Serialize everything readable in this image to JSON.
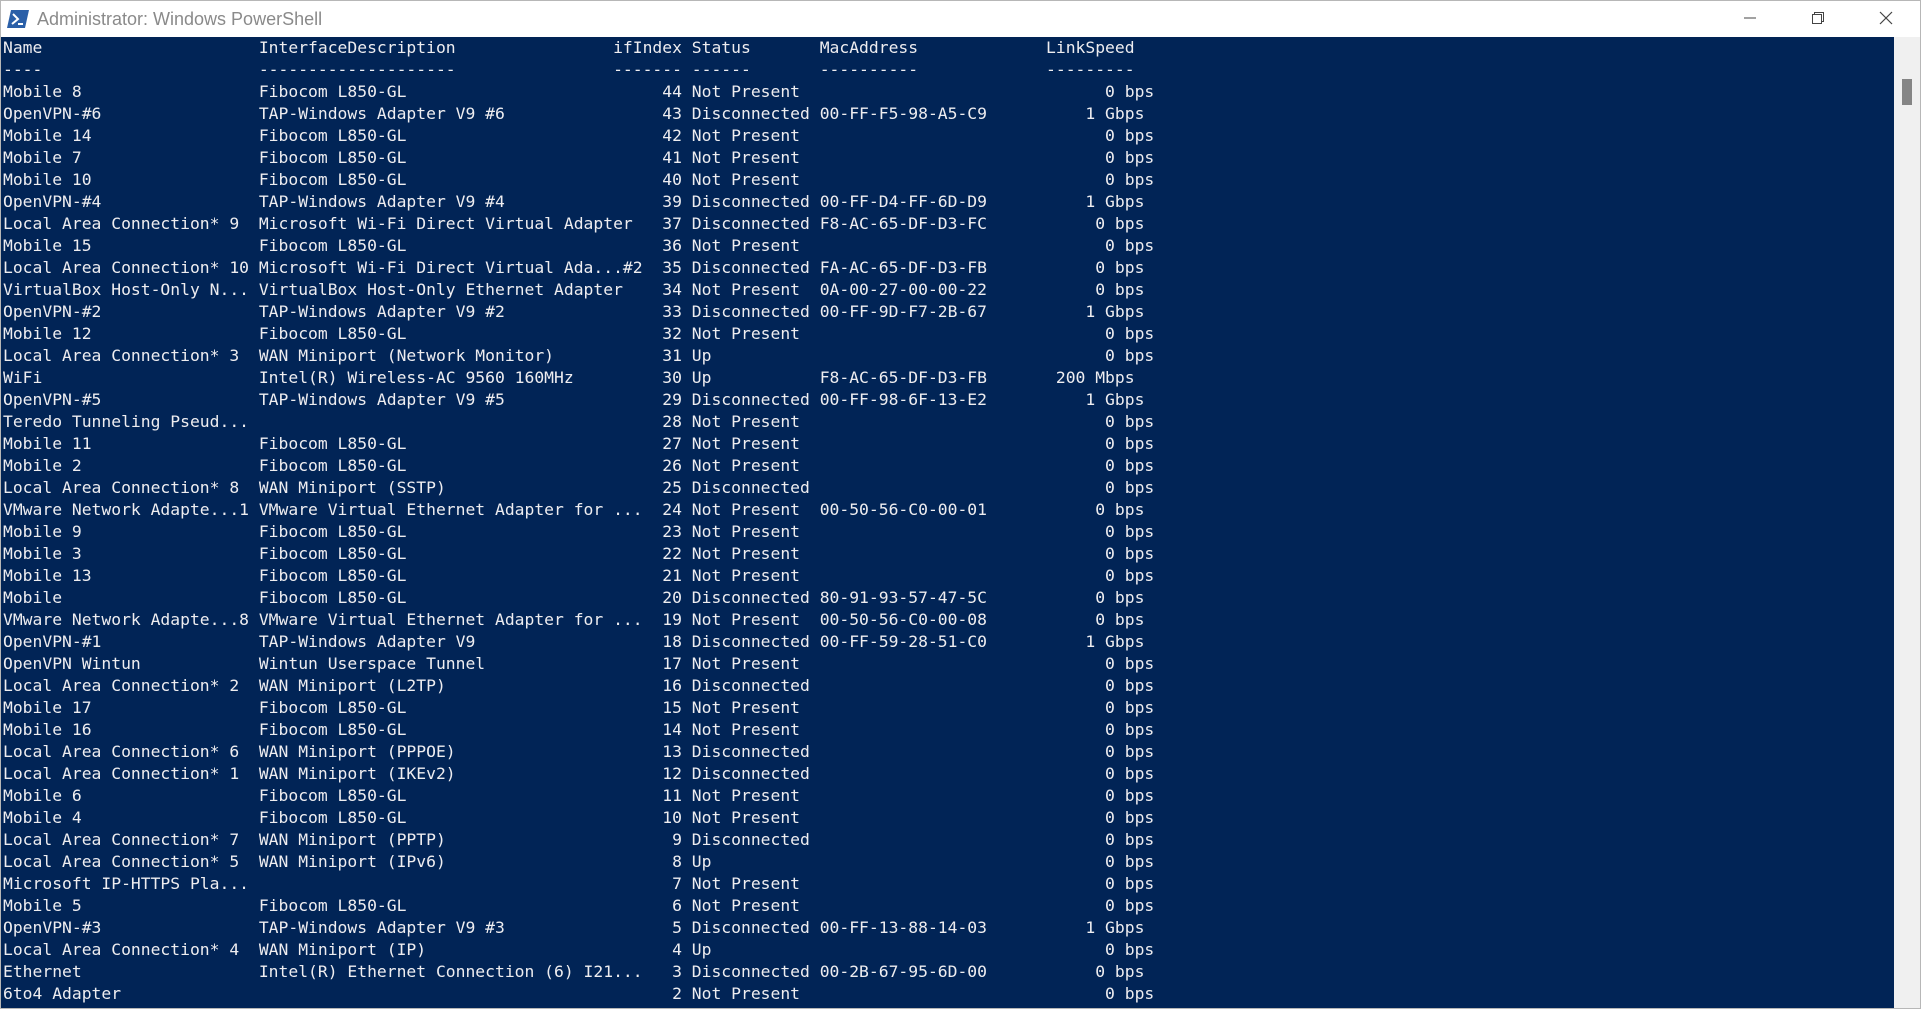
{
  "window": {
    "title": "Administrator: Windows PowerShell",
    "icon": "powershell-icon",
    "controls": [
      "minimize-icon",
      "restore-icon",
      "close-icon"
    ]
  },
  "console": {
    "header": "Name                      InterfaceDescription                ifIndex Status       MacAddress             LinkSpeed",
    "separator": "----                      --------------------                ------- ------       ----------             ---------",
    "rows": [
      "Mobile 8                  Fibocom L850-GL                          44 Not Present                               0 bps",
      "OpenVPN-#6                TAP-Windows Adapter V9 #6                43 Disconnected 00-FF-F5-98-A5-C9          1 Gbps",
      "Mobile 14                 Fibocom L850-GL                          42 Not Present                               0 bps",
      "Mobile 7                  Fibocom L850-GL                          41 Not Present                               0 bps",
      "Mobile 10                 Fibocom L850-GL                          40 Not Present                               0 bps",
      "OpenVPN-#4                TAP-Windows Adapter V9 #4                39 Disconnected 00-FF-D4-FF-6D-D9          1 Gbps",
      "Local Area Connection* 9  Microsoft Wi-Fi Direct Virtual Adapter   37 Disconnected F8-AC-65-DF-D3-FC           0 bps",
      "Mobile 15                 Fibocom L850-GL                          36 Not Present                               0 bps",
      "Local Area Connection* 10 Microsoft Wi-Fi Direct Virtual Ada...#2  35 Disconnected FA-AC-65-DF-D3-FB           0 bps",
      "VirtualBox Host-Only N... VirtualBox Host-Only Ethernet Adapter    34 Not Present  0A-00-27-00-00-22           0 bps",
      "OpenVPN-#2                TAP-Windows Adapter V9 #2                33 Disconnected 00-FF-9D-F7-2B-67          1 Gbps",
      "Mobile 12                 Fibocom L850-GL                          32 Not Present                               0 bps",
      "Local Area Connection* 3  WAN Miniport (Network Monitor)           31 Up                                        0 bps",
      "WiFi                      Intel(R) Wireless-AC 9560 160MHz         30 Up           F8-AC-65-DF-D3-FB       200 Mbps",
      "OpenVPN-#5                TAP-Windows Adapter V9 #5                29 Disconnected 00-FF-98-6F-13-E2          1 Gbps",
      "Teredo Tunneling Pseud...                                          28 Not Present                               0 bps",
      "Mobile 11                 Fibocom L850-GL                          27 Not Present                               0 bps",
      "Mobile 2                  Fibocom L850-GL                          26 Not Present                               0 bps",
      "Local Area Connection* 8  WAN Miniport (SSTP)                      25 Disconnected                              0 bps",
      "VMware Network Adapte...1 VMware Virtual Ethernet Adapter for ...  24 Not Present  00-50-56-C0-00-01           0 bps",
      "Mobile 9                  Fibocom L850-GL                          23 Not Present                               0 bps",
      "Mobile 3                  Fibocom L850-GL                          22 Not Present                               0 bps",
      "Mobile 13                 Fibocom L850-GL                          21 Not Present                               0 bps",
      "Mobile                    Fibocom L850-GL                          20 Disconnected 80-91-93-57-47-5C           0 bps",
      "VMware Network Adapte...8 VMware Virtual Ethernet Adapter for ...  19 Not Present  00-50-56-C0-00-08           0 bps",
      "OpenVPN-#1                TAP-Windows Adapter V9                   18 Disconnected 00-FF-59-28-51-C0          1 Gbps",
      "OpenVPN Wintun            Wintun Userspace Tunnel                  17 Not Present                               0 bps",
      "Local Area Connection* 2  WAN Miniport (L2TP)                      16 Disconnected                              0 bps",
      "Mobile 17                 Fibocom L850-GL                          15 Not Present                               0 bps",
      "Mobile 16                 Fibocom L850-GL                          14 Not Present                               0 bps",
      "Local Area Connection* 6  WAN Miniport (PPPOE)                     13 Disconnected                              0 bps",
      "Local Area Connection* 1  WAN Miniport (IKEv2)                     12 Disconnected                              0 bps",
      "Mobile 6                  Fibocom L850-GL                          11 Not Present                               0 bps",
      "Mobile 4                  Fibocom L850-GL                          10 Not Present                               0 bps",
      "Local Area Connection* 7  WAN Miniport (PPTP)                       9 Disconnected                              0 bps",
      "Local Area Connection* 5  WAN Miniport (IPv6)                       8 Up                                        0 bps",
      "Microsoft IP-HTTPS Pla...                                           7 Not Present                               0 bps",
      "Mobile 5                  Fibocom L850-GL                           6 Not Present                               0 bps",
      "OpenVPN-#3                TAP-Windows Adapter V9 #3                 5 Disconnected 00-FF-13-88-14-03          1 Gbps",
      "Local Area Connection* 4  WAN Miniport (IP)                         4 Up                                        0 bps",
      "Ethernet                  Intel(R) Ethernet Connection (6) I21...   3 Disconnected 00-2B-67-95-6D-00           0 bps",
      "6to4 Adapter                                                        2 Not Present                               0 bps"
    ]
  },
  "colors": {
    "console_background": "#012456",
    "console_text": "#eeedf0",
    "titlebar_background": "#ffffff",
    "title_text": "#8a8a8a"
  }
}
